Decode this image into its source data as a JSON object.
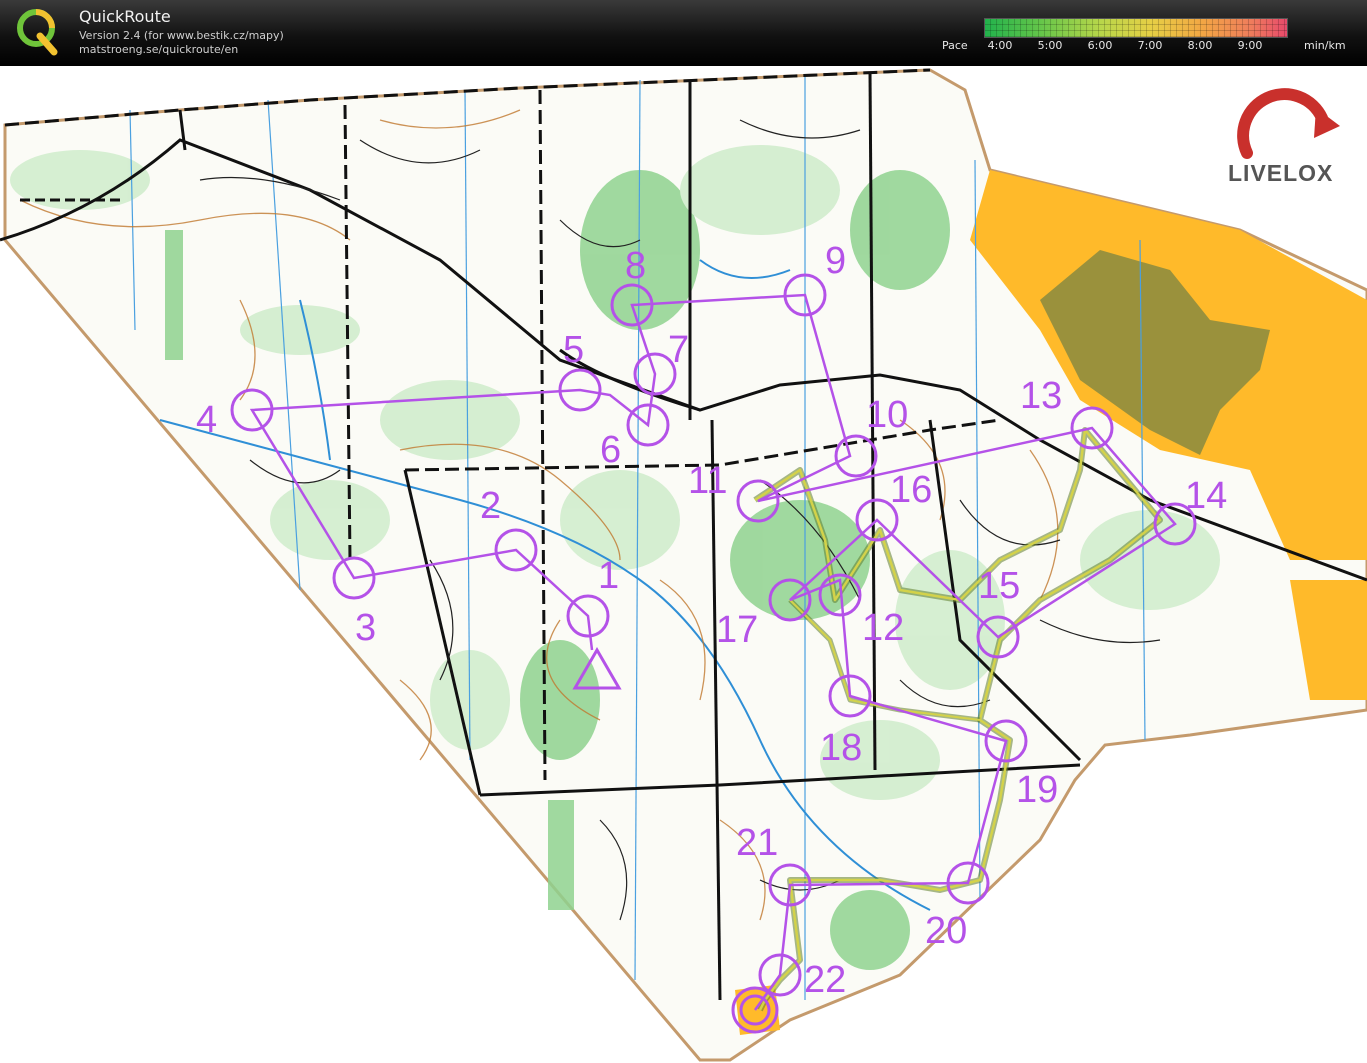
{
  "header": {
    "app_title": "QuickRoute",
    "version": "Version 2.4  (for www.bestik.cz/mapy)",
    "url": "matstroeng.se/quickroute/en",
    "pace_label": "Pace",
    "pace_unit": "min/km",
    "pace_ticks": [
      "4:00",
      "5:00",
      "6:00",
      "7:00",
      "8:00",
      "9:00"
    ]
  },
  "branding": {
    "livelox_text": "LIVELOX"
  },
  "course": {
    "color": "#b452e8",
    "start_symbol": "triangle",
    "controls": [
      {
        "label": "1"
      },
      {
        "label": "2"
      },
      {
        "label": "3"
      },
      {
        "label": "4"
      },
      {
        "label": "5"
      },
      {
        "label": "6"
      },
      {
        "label": "7"
      },
      {
        "label": "8"
      },
      {
        "label": "9"
      },
      {
        "label": "10"
      },
      {
        "label": "11"
      },
      {
        "label": "12"
      },
      {
        "label": "13"
      },
      {
        "label": "14"
      },
      {
        "label": "15"
      },
      {
        "label": "16"
      },
      {
        "label": "17"
      },
      {
        "label": "18"
      },
      {
        "label": "19"
      },
      {
        "label": "20"
      },
      {
        "label": "21"
      },
      {
        "label": "22"
      }
    ]
  },
  "colors": {
    "forest_green": "#8fd28f",
    "light_green": "#cfeccb",
    "open_yellow": "#ffba2a",
    "olive": "#8f8d3e",
    "road_black": "#111111",
    "route_track": "#9aa63a"
  }
}
